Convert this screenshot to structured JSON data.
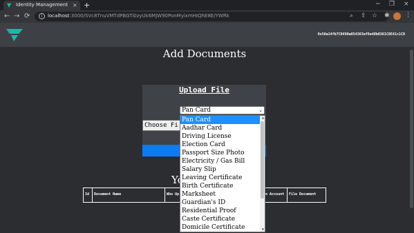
{
  "browser": {
    "tab_title": "Identity Management",
    "tab_close": "×",
    "new_tab": "+",
    "url_host": "localhost",
    "url_path": ":3000/SVc8TnuVMTdPBGTi0zyUk6MjW90PonMyixmHIQhE8E/YWRk",
    "back": "←",
    "forward": "→",
    "reload": "⟳",
    "window_controls": [
      "−",
      "❐",
      "×"
    ],
    "icons": [
      "search-icon",
      "share-icon",
      "star-icon",
      "extensions-icon"
    ]
  },
  "header": {
    "account_address": "0x58a14fb7C0490a854363ef9e48b0361C8E41c1C8"
  },
  "main": {
    "title": "Add Documents",
    "upload_title": "Upload File",
    "selected_document_type": "Pan Card",
    "file_input_label": "Choose Fi",
    "your_heading_visible": "Yo"
  },
  "table": {
    "headers": [
      "Id",
      "Document Name",
      "Who Up",
      "on Account",
      "File Document"
    ]
  },
  "dropdown": {
    "options": [
      "Pan Card",
      "Aadhar Card",
      "Driving License",
      "Election Card",
      "Passport Size Photo",
      "Electricity / Gas Bill",
      "Salary Slip",
      "Leaving Certificate",
      "Birth Certificate",
      "Marksheet",
      "Guardian's ID",
      "Residential Proof",
      "Caste Certificate",
      "Domicile Certificate"
    ],
    "selected_index": 0
  },
  "colors": {
    "accent": "#0d7bf5",
    "selected_option": "#1e90ff",
    "logo_teal": "#1bb8a8",
    "page_background": "#2b2d30"
  }
}
